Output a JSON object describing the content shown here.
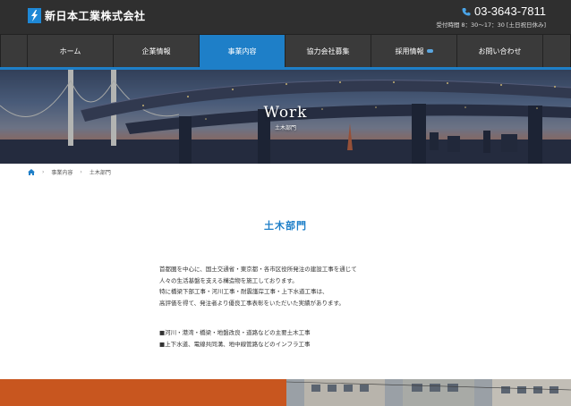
{
  "header": {
    "company_name": "新日本工業株式会社",
    "phone": "03-3643-7811",
    "hours": "受付時間 8：30〜17：30 [土日祝日休み]"
  },
  "nav": {
    "items": [
      {
        "label": "ホーム"
      },
      {
        "label": "企業情報"
      },
      {
        "label": "事業内容"
      },
      {
        "label": "協力会社募集"
      },
      {
        "label": "採用情報"
      },
      {
        "label": "お問い合わせ"
      }
    ],
    "active_index": 2
  },
  "hero": {
    "title": "Work",
    "subtitle": "土木部門"
  },
  "breadcrumb": {
    "items": [
      "事業内容",
      "土木部門"
    ]
  },
  "main": {
    "heading": "土木部門",
    "paragraph_lines": [
      "首都圏を中心に、国土交通省・東京都・各市区役所発注の建設工事を通じて",
      "人々の生活基盤を支える構造物を施工しております。",
      "特に橋梁下部工事・河川工事・耐震護岸工事・上下水道工事は、",
      "高評価を得て、発注者より優良工事表彰をいただいた実績があります。"
    ],
    "bullets": [
      "■河川・港湾・橋梁・地盤改良・道路などの主要土木工事",
      "■上下水道、電線共同溝、地中線管路などのインフラ工事"
    ]
  },
  "colors": {
    "accent": "#1e7fc8",
    "header_bg": "#2f2f2f",
    "nav_bg": "#3a3a3a",
    "footer_orange": "#c8561f"
  }
}
